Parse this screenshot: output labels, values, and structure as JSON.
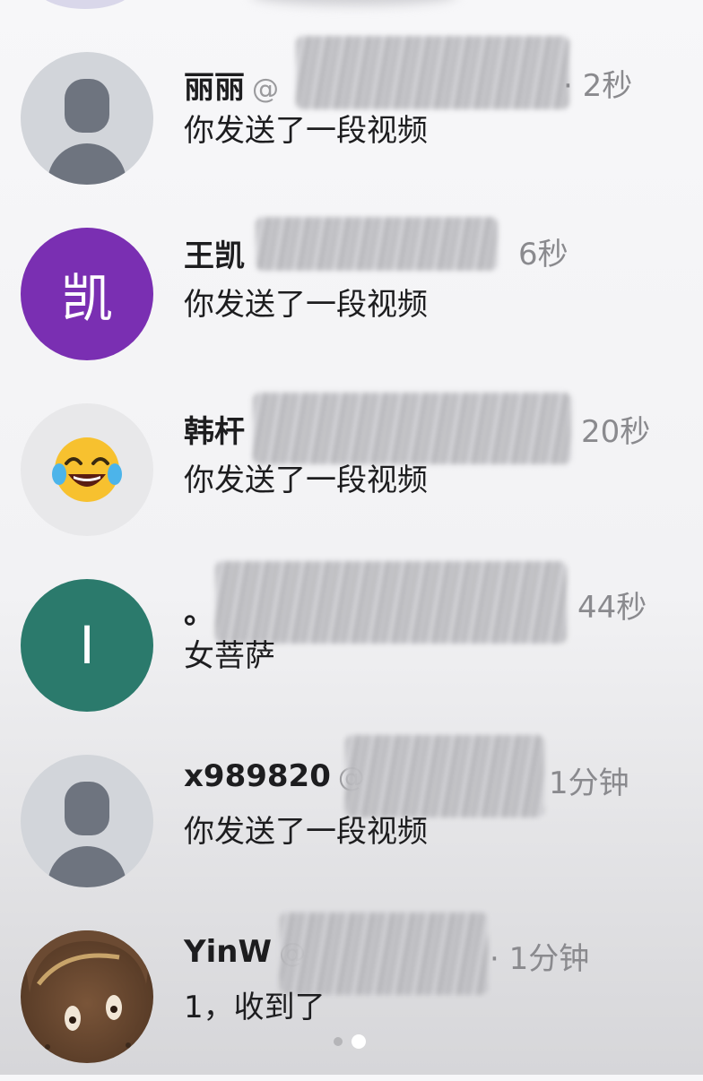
{
  "conversations": [
    {
      "name": "丽丽",
      "handle": "@",
      "time": "· 2秒",
      "message": "你发送了一段视频",
      "avatar": "default-person-icon"
    },
    {
      "name": "王凯",
      "time": "6秒",
      "message": "你发送了一段视频",
      "avatar_text": "凯",
      "avatar_color": "#7a2fb2"
    },
    {
      "name": "韩杆",
      "time": "20秒",
      "message": "你发送了一段视频",
      "avatar": "tears-of-joy-emoji"
    },
    {
      "name": "。",
      "time": "44秒",
      "message": "女菩萨",
      "avatar_text": "I",
      "avatar_color": "#2b7a6c"
    },
    {
      "name": "x989820",
      "handle": "@",
      "time": "1分钟",
      "message": "你发送了一段视频",
      "avatar": "default-person-icon"
    },
    {
      "name": "YinW",
      "handle": "@",
      "time": "· 1分钟",
      "message": "1，收到了",
      "avatar": "user-photo"
    }
  ],
  "pagination": {
    "current": 2,
    "total": 2
  }
}
